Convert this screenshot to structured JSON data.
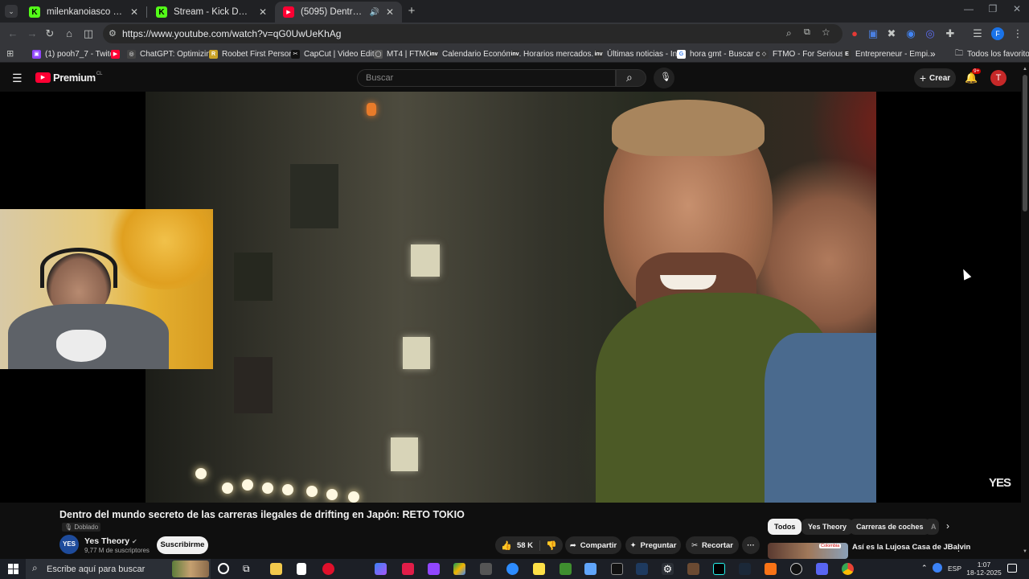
{
  "browser": {
    "tabs": [
      {
        "title": "milenkanoiasco Stream - Watch",
        "favicon_color": "#53fc18",
        "favicon_letter": "K"
      },
      {
        "title": "Stream - Kick Dashboard",
        "favicon_color": "#53fc18",
        "favicon_letter": "K"
      },
      {
        "title": "(5095) Dentro del mundo s",
        "favicon_color": "#ff0033",
        "favicon_letter": "▶"
      }
    ],
    "new_tab_label": "+",
    "url": "https://www.youtube.com/watch?v=qG0UwUeKhAg",
    "bookmarks": [
      {
        "label": "(1) pooh7_7 - Twitch",
        "color": "#9146ff",
        "letter": "▣"
      },
      {
        "label": "",
        "color": "#ff0033",
        "letter": "▶"
      },
      {
        "label": "ChatGPT: Optimizin...",
        "color": "#202124",
        "letter": "◎"
      },
      {
        "label": "Roobet First Person...",
        "color": "#c9a227",
        "letter": "R"
      },
      {
        "label": "CapCut | Video Edit...",
        "color": "#111111",
        "letter": "✂"
      },
      {
        "label": "MT4 | FTMO",
        "color": "#202124",
        "letter": "◯"
      },
      {
        "label": "Calendario Económi...",
        "color": "#202124",
        "letter": "inv"
      },
      {
        "label": "Horarios mercados...",
        "color": "#202124",
        "letter": "inv"
      },
      {
        "label": "Últimas noticias - In...",
        "color": "#202124",
        "letter": "inv"
      },
      {
        "label": "hora gmt - Buscar c...",
        "color": "#ffffff",
        "letter": "G"
      },
      {
        "label": "FTMO - For Serious...",
        "color": "#202124",
        "letter": "◇"
      },
      {
        "label": "Entrepreneur - Empi...",
        "color": "#202124",
        "letter": "E"
      }
    ],
    "bookmarks_more": "»",
    "all_bookmarks": "Todos los favoritos"
  },
  "youtube": {
    "logo_text": "Premium",
    "logo_region": "CL",
    "search_placeholder": "Buscar",
    "create_label": "Crear",
    "notifications_badge": "9+",
    "avatar_letter": "T",
    "video_overlay_logo": "YES",
    "video_title": "Dentro del mundo secreto de las carreras ilegales de drifting en Japón: RETO TOKIO",
    "dubbed_label": "Doblado",
    "channel": {
      "name": "Yes Theory",
      "subscribers": "9,77 M de suscriptores",
      "avatar_text": "YES"
    },
    "subscribe_label": "Suscribirme",
    "likes": "58 K",
    "share_label": "Compartir",
    "ask_label": "Preguntar",
    "clip_label": "Recortar",
    "more_label": "···",
    "chips": [
      "Todos",
      "Yes Theory",
      "Carreras de coches",
      "A"
    ],
    "recommendation": {
      "title": "Así es la Lujosa Casa de JBalvin",
      "badge": "Colombia"
    }
  },
  "taskbar": {
    "search_placeholder": "Escribe aquí para buscar",
    "language": "ESP",
    "time": "1:07",
    "date": "18-12-2025"
  },
  "colors": {
    "youtube_red": "#ff0033",
    "background": "#0f0f0f",
    "kick_green": "#53fc18"
  }
}
